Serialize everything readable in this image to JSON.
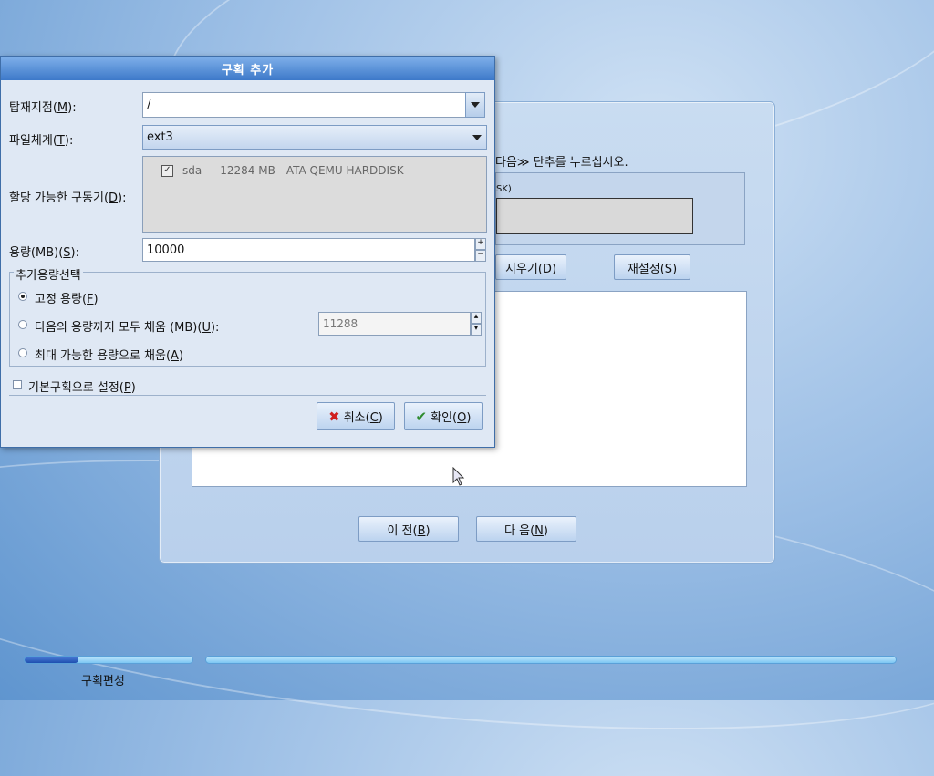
{
  "background_window": {
    "instruction_text": "다음≫ 단추를 누르십시오.",
    "disk_label_fragment": "SK)",
    "delete_button": {
      "text": "지우기(",
      "mnemonic": "D",
      "close": ")"
    },
    "reset_button": {
      "text": "재설정(",
      "mnemonic": "S",
      "close": ")"
    },
    "back_button": {
      "text": "이 전(",
      "mnemonic": "B",
      "close": ")"
    },
    "next_button": {
      "text": "다 음(",
      "mnemonic": "N",
      "close": ")"
    }
  },
  "dialog": {
    "title": "구획 추가",
    "mount_point": {
      "label": "탑재지점(",
      "mnemonic": "M",
      "close": "):",
      "value": "/"
    },
    "filesystem": {
      "label": "파일체계(",
      "mnemonic": "T",
      "close": "):",
      "value": "ext3"
    },
    "drives": {
      "label": "할당 가능한 구동기(",
      "mnemonic": "D",
      "close": "):",
      "items": [
        {
          "name": "sda",
          "size": "12284 MB",
          "model": "ATA QEMU HARDDISK",
          "checked": true
        }
      ]
    },
    "size": {
      "label": "용량(MB)(",
      "mnemonic": "S",
      "close": "):",
      "value": "10000"
    },
    "additional_size": {
      "legend": "추가용량선택",
      "fixed": {
        "text": "고정 용량(",
        "mnemonic": "F",
        "close": ")",
        "selected": true
      },
      "fill_to": {
        "text": "다음의 용량까지 모두 채움 (MB)(",
        "mnemonic": "U",
        "close": "):",
        "value": "11288"
      },
      "fill_max": {
        "text": "최대 가능한 용량으로 채움(",
        "mnemonic": "A",
        "close": ")"
      }
    },
    "primary": {
      "text": "기본구획으로 설정(",
      "mnemonic": "P",
      "close": ")",
      "checked": false
    },
    "cancel_button": {
      "text": "취소(",
      "mnemonic": "C",
      "close": ")"
    },
    "ok_button": {
      "text": "확인(",
      "mnemonic": "O",
      "close": ")"
    }
  },
  "progress": {
    "step_label": "구획편성",
    "step_fill": 0.32
  },
  "colors": {
    "accent": "#3d79c9",
    "cancel_icon": "#d02020",
    "ok_icon": "#2e8b2e"
  }
}
